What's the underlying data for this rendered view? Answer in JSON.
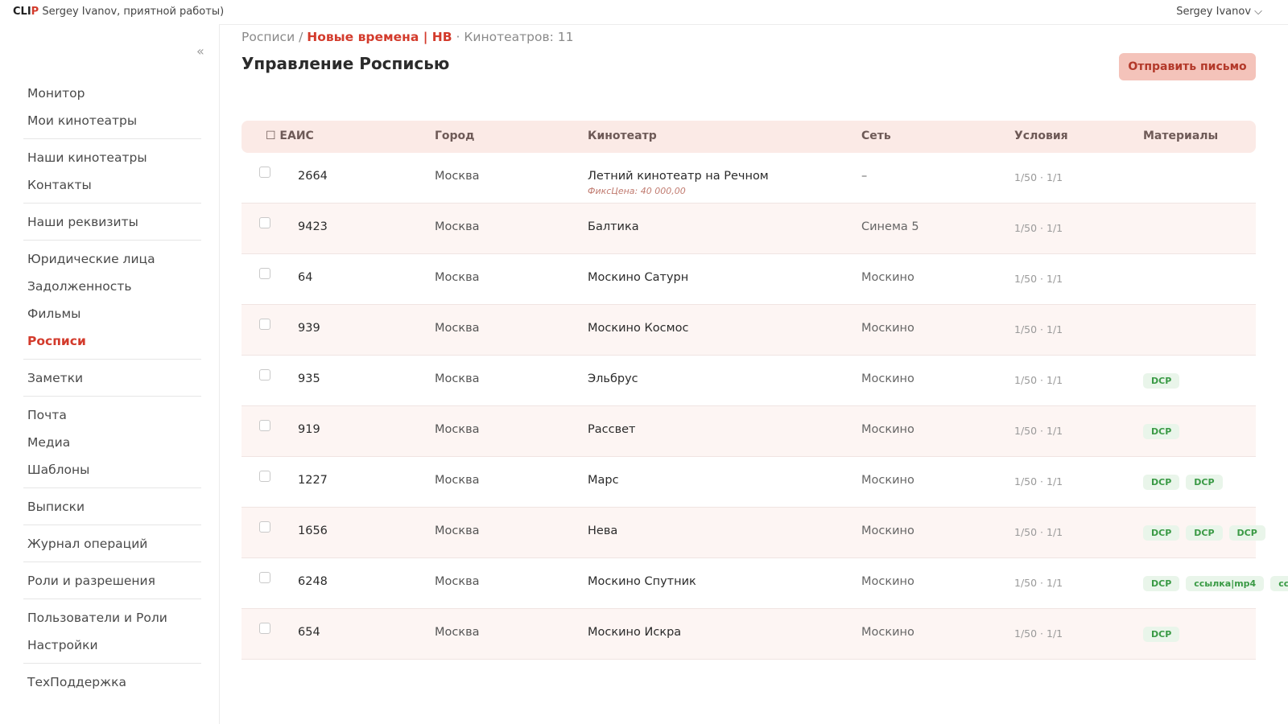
{
  "header": {
    "logo_a": "CLI",
    "logo_b": "P",
    "greeting": "Sergey Ivanov, приятной работы)",
    "user_menu": "Sergey Ivanov ⌵"
  },
  "sidebar": {
    "collapse": "«",
    "items": [
      {
        "label": "Монитор"
      },
      {
        "label": "Мои кинотеатры"
      },
      {
        "label": "Наши кинотеатры"
      },
      {
        "label": "Контакты"
      },
      {
        "label": "Наши реквизиты"
      },
      {
        "label": "Юридические лица"
      },
      {
        "label": "Задолженность"
      },
      {
        "label": "Фильмы"
      },
      {
        "label": "Росписи",
        "active": true
      },
      {
        "label": "Заметки"
      },
      {
        "label": "Почта"
      },
      {
        "label": "Медиа"
      },
      {
        "label": "Шаблоны"
      },
      {
        "label": "Выписки"
      },
      {
        "label": "Журнал операций"
      },
      {
        "label": "Роли и разрешения"
      },
      {
        "label": "Пользователи и Роли"
      },
      {
        "label": "Настройки"
      },
      {
        "label": "ТехПоддержка"
      }
    ]
  },
  "breadcrumb": {
    "parent": "Росписи",
    "sep": " / ",
    "current": "Новые времена | НВ",
    "count": " · Кинотеатров: 11"
  },
  "page": {
    "title": "Управление Росписью",
    "send_button": "Отправить письмо"
  },
  "table": {
    "columns": {
      "eais": "☐ ЕАИС",
      "city": "Город",
      "cinema": "Кинотеатр",
      "network": "Сеть",
      "conditions": "Условия",
      "materials": "Материалы"
    },
    "rows": [
      {
        "eais": "2664",
        "city": "Москва",
        "cinema": "Летний кинотеатр на Речном",
        "fix": "ФиксЦена: 40 000,00",
        "network": "–",
        "conditions": "1/50 · 1/1",
        "materials": []
      },
      {
        "eais": "9423",
        "city": "Москва",
        "cinema": "Балтика",
        "network": "Синема 5",
        "conditions": "1/50 · 1/1",
        "materials": []
      },
      {
        "eais": "64",
        "city": "Москва",
        "cinema": "Москино Сатурн",
        "network": "Москино",
        "conditions": "1/50 · 1/1",
        "materials": []
      },
      {
        "eais": "939",
        "city": "Москва",
        "cinema": "Москино Космос",
        "network": "Москино",
        "conditions": "1/50 · 1/1",
        "materials": []
      },
      {
        "eais": "935",
        "city": "Москва",
        "cinema": "Эльбрус",
        "network": "Москино",
        "conditions": "1/50 · 1/1",
        "materials": [
          "DCP"
        ]
      },
      {
        "eais": "919",
        "city": "Москва",
        "cinema": "Рассвет",
        "network": "Москино",
        "conditions": "1/50 · 1/1",
        "materials": [
          "DCP"
        ]
      },
      {
        "eais": "1227",
        "city": "Москва",
        "cinema": "Марс",
        "network": "Москино",
        "conditions": "1/50 · 1/1",
        "materials": [
          "DCP",
          "DCP"
        ]
      },
      {
        "eais": "1656",
        "city": "Москва",
        "cinema": "Нева",
        "network": "Москино",
        "conditions": "1/50 · 1/1",
        "materials": [
          "DCP",
          "DCP",
          "DCP"
        ]
      },
      {
        "eais": "6248",
        "city": "Москва",
        "cinema": "Москино Спутник",
        "network": "Москино",
        "conditions": "1/50 · 1/1",
        "materials": [
          "DCP",
          "ссылка|mp4",
          "сс"
        ]
      },
      {
        "eais": "654",
        "city": "Москва",
        "cinema": "Москино Искра",
        "network": "Москино",
        "conditions": "1/50 · 1/1",
        "materials": [
          "DCP"
        ]
      }
    ]
  }
}
